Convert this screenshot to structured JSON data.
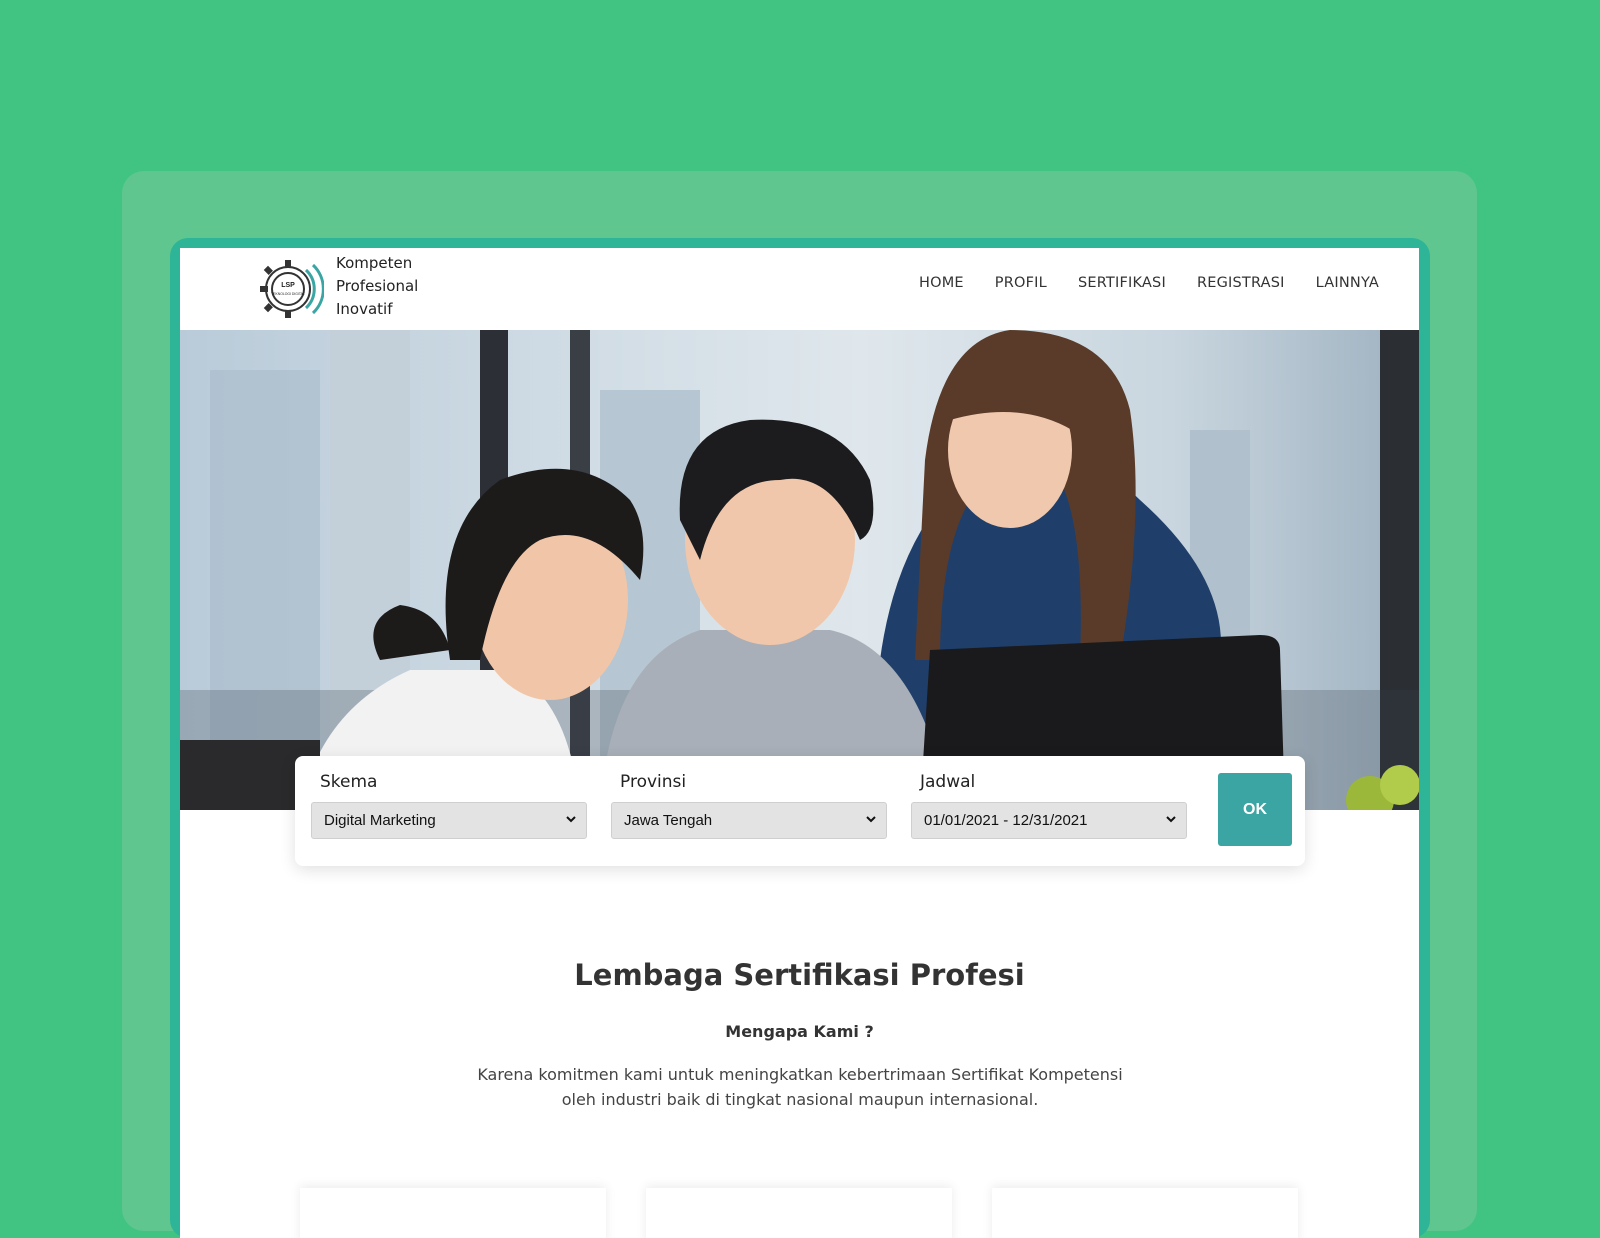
{
  "brand": {
    "logo_mark_text": "LSP",
    "logo_mark_subtext": "TEKNOLOGI DIGITAL",
    "name_lines": [
      "Kompeten",
      "Profesional",
      "Inovatif"
    ]
  },
  "nav": {
    "items": [
      "HOME",
      "PROFIL",
      "SERTIFIKASI",
      "REGISTRASI",
      "LAINNYA"
    ]
  },
  "hero": {
    "image": "photo-three-colleagues-looking-at-laptop"
  },
  "search": {
    "skema": {
      "label": "Skema",
      "value": "Digital Marketing"
    },
    "provinsi": {
      "label": "Provinsi",
      "value": "Jawa Tengah"
    },
    "jadwal": {
      "label": "Jadwal",
      "value": "01/01/2021 - 12/31/2021"
    },
    "ok_label": "OK"
  },
  "content": {
    "title": "Lembaga Sertifikasi Profesi",
    "subtitle": "Mengapa Kami ?",
    "description_line1": "Karena komitmen kami untuk meningkatkan kebertrimaan Sertifikat Kompetensi",
    "description_line2": "oleh industri baik di tingkat nasional maupun internasional."
  },
  "colors": {
    "background": "#41c482",
    "panel": "#5ec68e",
    "frame": "#2eb597",
    "accent_button": "#3aa5a3"
  }
}
